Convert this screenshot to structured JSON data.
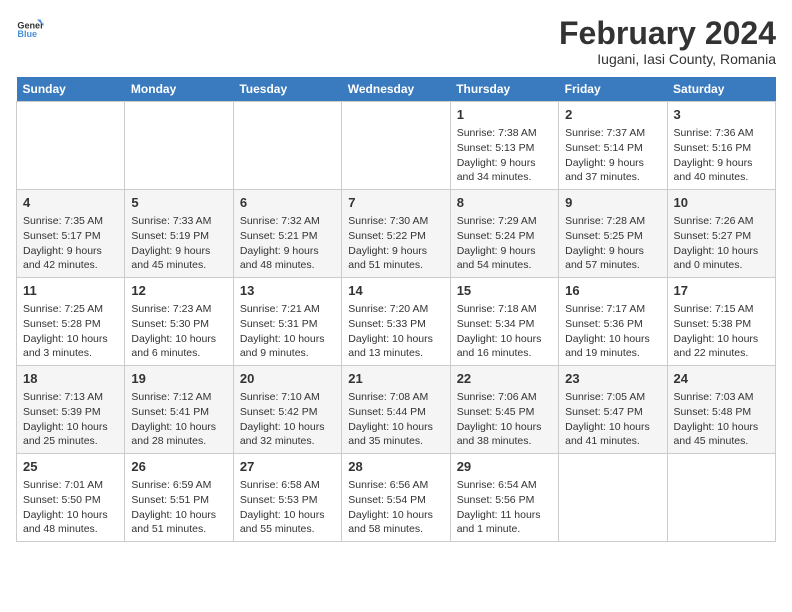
{
  "logo": {
    "text_general": "General",
    "text_blue": "Blue"
  },
  "title": "February 2024",
  "subtitle": "Iugani, Iasi County, Romania",
  "days_of_week": [
    "Sunday",
    "Monday",
    "Tuesday",
    "Wednesday",
    "Thursday",
    "Friday",
    "Saturday"
  ],
  "weeks": [
    [
      {
        "day": "",
        "info": ""
      },
      {
        "day": "",
        "info": ""
      },
      {
        "day": "",
        "info": ""
      },
      {
        "day": "",
        "info": ""
      },
      {
        "day": "1",
        "info": "Sunrise: 7:38 AM\nSunset: 5:13 PM\nDaylight: 9 hours and 34 minutes."
      },
      {
        "day": "2",
        "info": "Sunrise: 7:37 AM\nSunset: 5:14 PM\nDaylight: 9 hours and 37 minutes."
      },
      {
        "day": "3",
        "info": "Sunrise: 7:36 AM\nSunset: 5:16 PM\nDaylight: 9 hours and 40 minutes."
      }
    ],
    [
      {
        "day": "4",
        "info": "Sunrise: 7:35 AM\nSunset: 5:17 PM\nDaylight: 9 hours and 42 minutes."
      },
      {
        "day": "5",
        "info": "Sunrise: 7:33 AM\nSunset: 5:19 PM\nDaylight: 9 hours and 45 minutes."
      },
      {
        "day": "6",
        "info": "Sunrise: 7:32 AM\nSunset: 5:21 PM\nDaylight: 9 hours and 48 minutes."
      },
      {
        "day": "7",
        "info": "Sunrise: 7:30 AM\nSunset: 5:22 PM\nDaylight: 9 hours and 51 minutes."
      },
      {
        "day": "8",
        "info": "Sunrise: 7:29 AM\nSunset: 5:24 PM\nDaylight: 9 hours and 54 minutes."
      },
      {
        "day": "9",
        "info": "Sunrise: 7:28 AM\nSunset: 5:25 PM\nDaylight: 9 hours and 57 minutes."
      },
      {
        "day": "10",
        "info": "Sunrise: 7:26 AM\nSunset: 5:27 PM\nDaylight: 10 hours and 0 minutes."
      }
    ],
    [
      {
        "day": "11",
        "info": "Sunrise: 7:25 AM\nSunset: 5:28 PM\nDaylight: 10 hours and 3 minutes."
      },
      {
        "day": "12",
        "info": "Sunrise: 7:23 AM\nSunset: 5:30 PM\nDaylight: 10 hours and 6 minutes."
      },
      {
        "day": "13",
        "info": "Sunrise: 7:21 AM\nSunset: 5:31 PM\nDaylight: 10 hours and 9 minutes."
      },
      {
        "day": "14",
        "info": "Sunrise: 7:20 AM\nSunset: 5:33 PM\nDaylight: 10 hours and 13 minutes."
      },
      {
        "day": "15",
        "info": "Sunrise: 7:18 AM\nSunset: 5:34 PM\nDaylight: 10 hours and 16 minutes."
      },
      {
        "day": "16",
        "info": "Sunrise: 7:17 AM\nSunset: 5:36 PM\nDaylight: 10 hours and 19 minutes."
      },
      {
        "day": "17",
        "info": "Sunrise: 7:15 AM\nSunset: 5:38 PM\nDaylight: 10 hours and 22 minutes."
      }
    ],
    [
      {
        "day": "18",
        "info": "Sunrise: 7:13 AM\nSunset: 5:39 PM\nDaylight: 10 hours and 25 minutes."
      },
      {
        "day": "19",
        "info": "Sunrise: 7:12 AM\nSunset: 5:41 PM\nDaylight: 10 hours and 28 minutes."
      },
      {
        "day": "20",
        "info": "Sunrise: 7:10 AM\nSunset: 5:42 PM\nDaylight: 10 hours and 32 minutes."
      },
      {
        "day": "21",
        "info": "Sunrise: 7:08 AM\nSunset: 5:44 PM\nDaylight: 10 hours and 35 minutes."
      },
      {
        "day": "22",
        "info": "Sunrise: 7:06 AM\nSunset: 5:45 PM\nDaylight: 10 hours and 38 minutes."
      },
      {
        "day": "23",
        "info": "Sunrise: 7:05 AM\nSunset: 5:47 PM\nDaylight: 10 hours and 41 minutes."
      },
      {
        "day": "24",
        "info": "Sunrise: 7:03 AM\nSunset: 5:48 PM\nDaylight: 10 hours and 45 minutes."
      }
    ],
    [
      {
        "day": "25",
        "info": "Sunrise: 7:01 AM\nSunset: 5:50 PM\nDaylight: 10 hours and 48 minutes."
      },
      {
        "day": "26",
        "info": "Sunrise: 6:59 AM\nSunset: 5:51 PM\nDaylight: 10 hours and 51 minutes."
      },
      {
        "day": "27",
        "info": "Sunrise: 6:58 AM\nSunset: 5:53 PM\nDaylight: 10 hours and 55 minutes."
      },
      {
        "day": "28",
        "info": "Sunrise: 6:56 AM\nSunset: 5:54 PM\nDaylight: 10 hours and 58 minutes."
      },
      {
        "day": "29",
        "info": "Sunrise: 6:54 AM\nSunset: 5:56 PM\nDaylight: 11 hours and 1 minute."
      },
      {
        "day": "",
        "info": ""
      },
      {
        "day": "",
        "info": ""
      }
    ]
  ]
}
